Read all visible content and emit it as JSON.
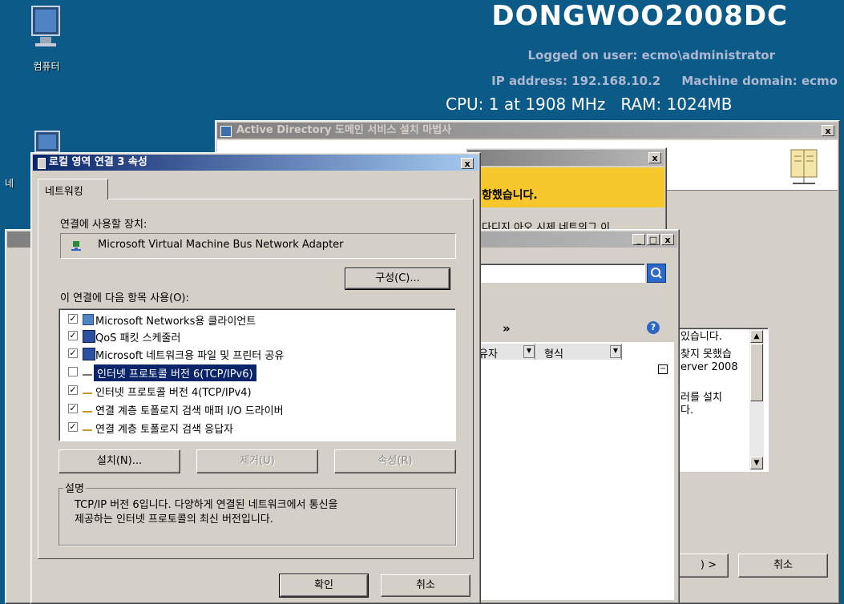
{
  "desktop": {
    "computer_label": "컴퓨터",
    "network_label_partial": "네"
  },
  "bginfo": {
    "hostname": "DONGWOO2008DC",
    "logged_on": "Logged on user: ecmo\\administrator",
    "ip": "IP address: 192.168.10.2     Machine domain: ecmo",
    "cpu_ram": "CPU: 1 at 1908 MHz   RAM: 1024MB"
  },
  "ad_wizard": {
    "title": "Active Directory 도메인 서비스 설치 마법사",
    "close": "x",
    "right_text": [
      "있습니다.",
      "찾지 못했습",
      "erver 2008",
      "",
      "러를 설치",
      "다."
    ],
    "cancel_label": "취소",
    "next_label": ") >"
  },
  "warning_dialog": {
    "close": "x",
    "banner_text": "항했습니다.",
    "body_partial": "다디지 아오 시제 네트의그 이"
  },
  "explorer": {
    "buttons": [
      "_",
      "□",
      "x"
    ],
    "breadcrumb_arrow": "»",
    "col_user": "유자",
    "col_type": "형식"
  },
  "props_dialog": {
    "title": "로컬 영역 연결 3 속성",
    "close": "x",
    "tab": "네트워킹",
    "connect_using_label": "연결에 사용할 장치:",
    "adapter_name": "Microsoft Virtual Machine Bus Network Adapter",
    "configure_button": "구성(C)...",
    "items_label": "이 연결에 다음 항목 사용(O):",
    "items": [
      {
        "label": "Microsoft Networks용 클라이언트",
        "checked": true,
        "icon": "network-client-icon"
      },
      {
        "label": "QoS 패킷 스케줄러",
        "checked": true,
        "icon": "computer-icon"
      },
      {
        "label": "Microsoft 네트워크용 파일 및 프린터 공유",
        "checked": true,
        "icon": "computer-icon"
      },
      {
        "label": "인터넷 프로토콜 버전 6(TCP/IPv6)",
        "checked": false,
        "selected": true,
        "icon": "protocol-icon"
      },
      {
        "label": "인터넷 프로토콜 버전 4(TCP/IPv4)",
        "checked": true,
        "icon": "protocol-icon"
      },
      {
        "label": "연결 계층 토폴로지 검색 매퍼 I/O 드라이버",
        "checked": true,
        "icon": "protocol-icon"
      },
      {
        "label": "연결 계층 토폴로지 검색 응답자",
        "checked": true,
        "icon": "protocol-icon"
      }
    ],
    "install_button": "설치(N)...",
    "uninstall_button": "제거(U)",
    "properties_button": "속성(R)",
    "description_group": "설명",
    "description_line1": "TCP/IP 버전 6입니다. 다양하게 연결된 네트워크에서 통신을",
    "description_line2": "제공하는 인터넷 프로토콜의 최신 버전입니다.",
    "ok_button": "확인",
    "cancel_button": "취소"
  },
  "colors": {
    "desktop": "#0b5a88",
    "active_title": "#0a246a",
    "selection": "#0a246a",
    "warning_banner": "#f7c72e"
  }
}
